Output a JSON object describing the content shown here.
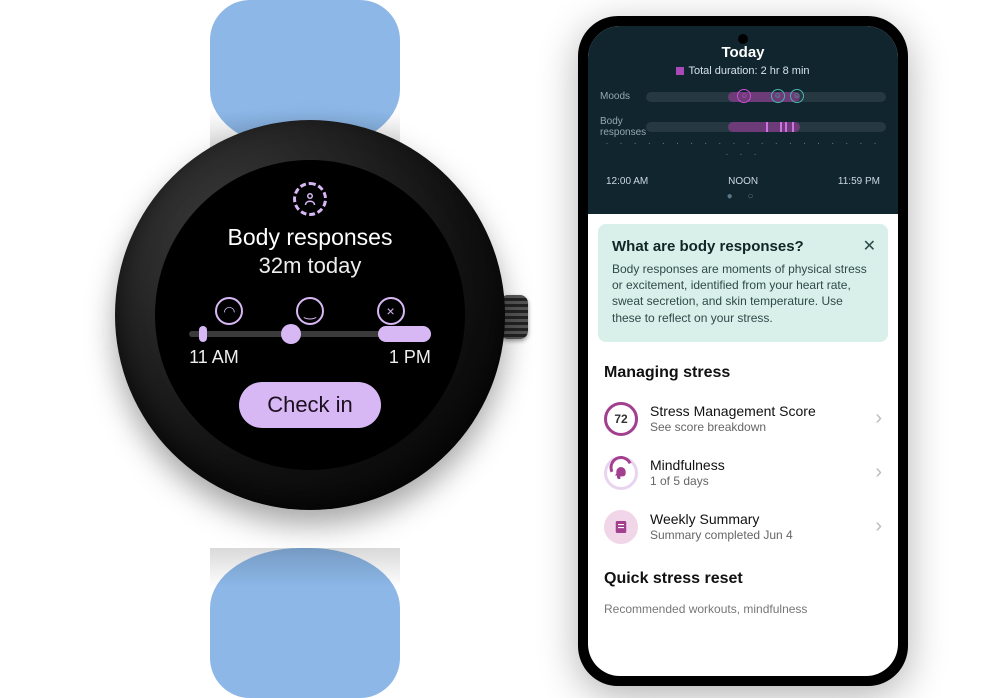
{
  "watch": {
    "title": "Body responses",
    "subtitle": "32m today",
    "time_left": "11 AM",
    "time_right": "1 PM",
    "button": "Check in"
  },
  "phone": {
    "header": {
      "title": "Today",
      "legend": "Total duration: 2 hr 8 min",
      "row_moods": "Moods",
      "row_body": "Body responses",
      "tl_left": "12:00 AM",
      "tl_mid": "NOON",
      "tl_right": "11:59 PM"
    },
    "card": {
      "title": "What are body responses?",
      "body": "Body responses are moments of physical stress or excitement, identified from your heart rate, sweat secretion, and skin temperature. Use these to reflect on your stress."
    },
    "managing": {
      "heading": "Managing stress",
      "items": [
        {
          "title": "Stress Management Score",
          "sub": "See score breakdown",
          "score": "72"
        },
        {
          "title": "Mindfulness",
          "sub": "1 of 5 days"
        },
        {
          "title": "Weekly Summary",
          "sub": "Summary completed Jun 4"
        }
      ]
    },
    "quick": {
      "heading": "Quick stress reset",
      "sub": "Recommended workouts, mindfulness"
    }
  }
}
